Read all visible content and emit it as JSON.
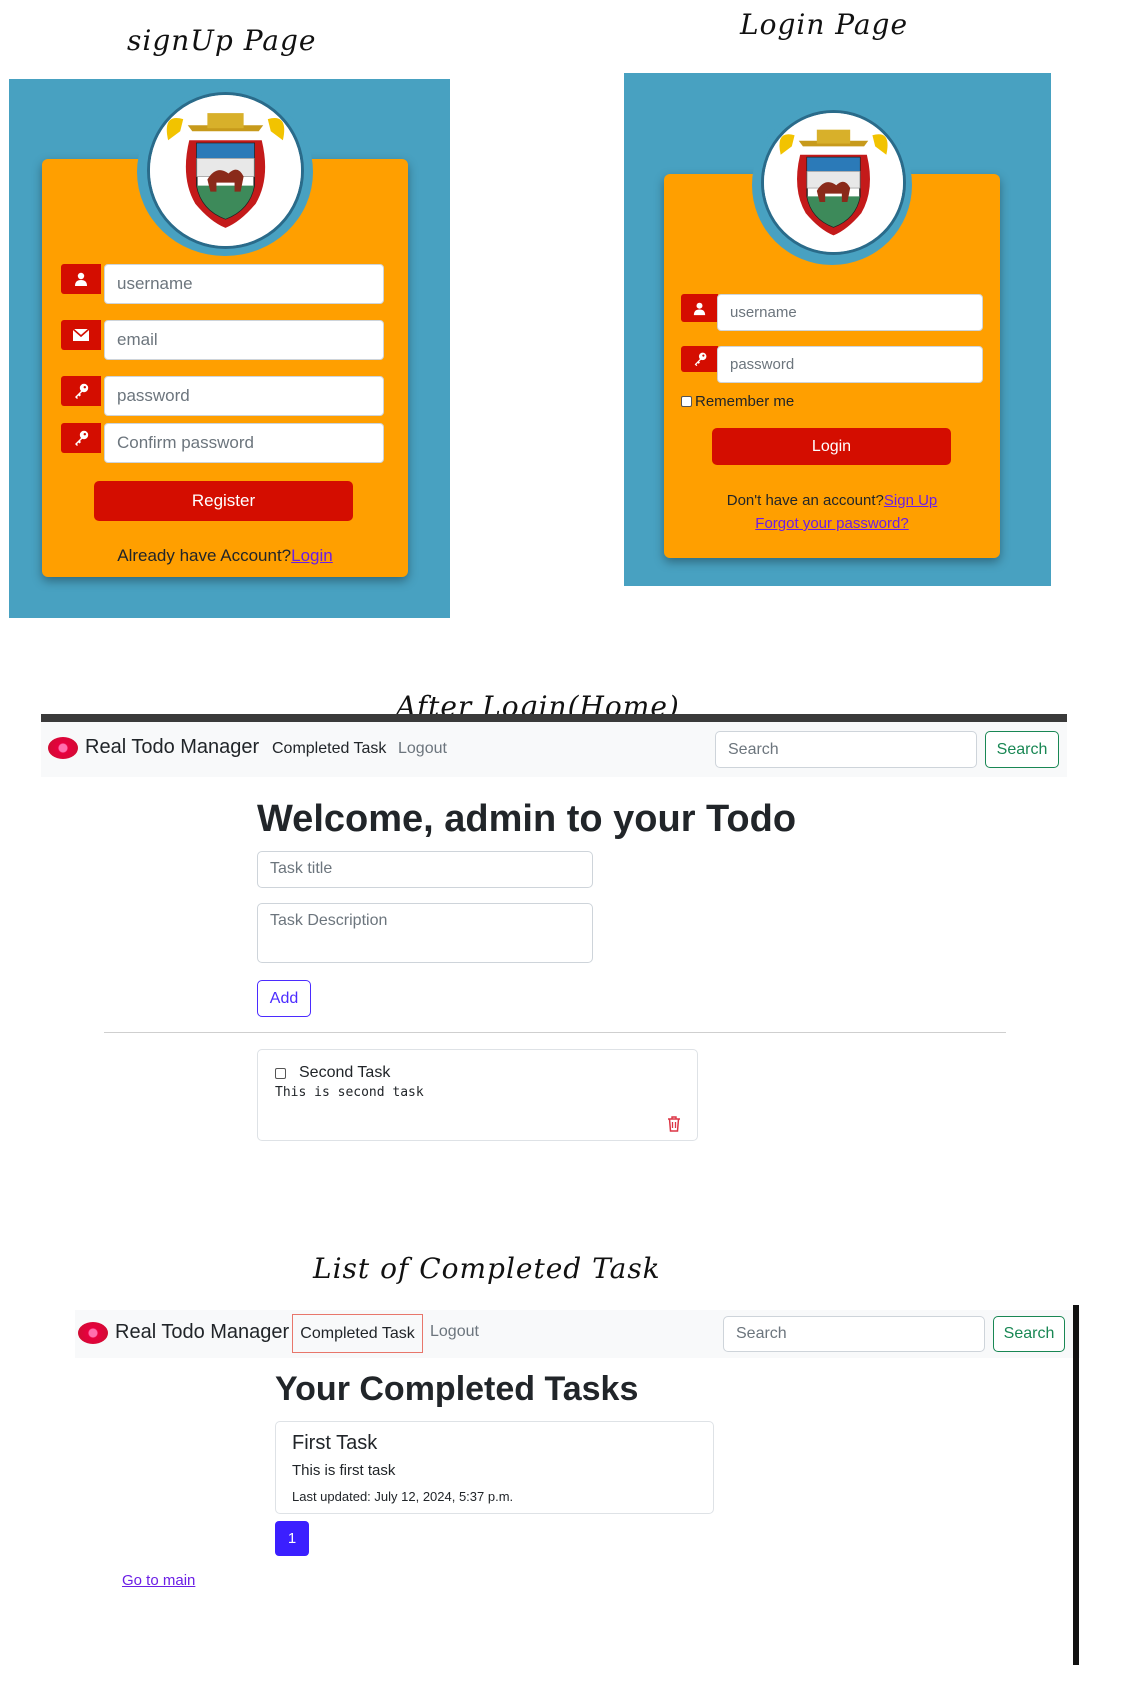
{
  "labels": {
    "signup": "signUp Page",
    "login": "Login Page",
    "home": "After Login(Home)",
    "completed": "List of Completed Task"
  },
  "signup": {
    "username_placeholder": "username",
    "email_placeholder": "email",
    "password_placeholder": "password",
    "confirm_placeholder": "Confirm password",
    "register_label": "Register",
    "footer_text": "Already have Account?",
    "footer_link": "Login"
  },
  "login": {
    "username_placeholder": "username",
    "password_placeholder": "password",
    "remember_label": "Remember me",
    "login_label": "Login",
    "no_account_text": "Don't have an account?",
    "signup_link": "Sign Up",
    "forgot_link": "Forgot your password?"
  },
  "navbar": {
    "brand": "Real Todo Manager",
    "completed_link": "Completed Task",
    "logout_link": "Logout",
    "search_placeholder": "Search",
    "search_button": "Search"
  },
  "home": {
    "heading": "Welcome, admin to your Todo",
    "task_title_placeholder": "Task title",
    "task_desc_placeholder": "Task Description",
    "add_button": "Add",
    "tasks": [
      {
        "title": "Second Task",
        "description": "This is second task"
      }
    ]
  },
  "completed": {
    "heading": "Your Completed Tasks",
    "tasks": [
      {
        "title": "First Task",
        "description": "This is first task",
        "updated": "Last updated: July 12, 2024, 5:37 p.m."
      }
    ],
    "page": "1",
    "go_main": "Go to main"
  },
  "colors": {
    "panel_bg": "#48a1c1",
    "card_orange": "#ff9f00",
    "accent_red": "#d40d00",
    "search_green": "#198754",
    "add_purple": "#4b2bff",
    "link_purple": "#6b1ee6"
  }
}
